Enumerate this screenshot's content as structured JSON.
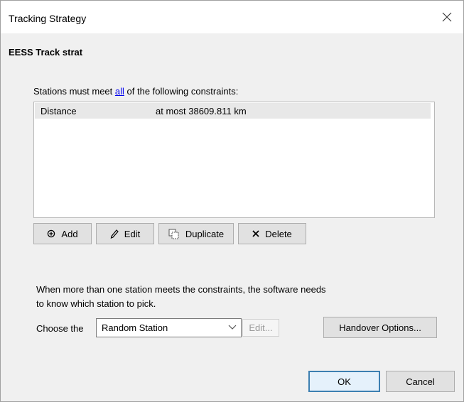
{
  "window": {
    "title": "Tracking Strategy",
    "close_icon": "close-icon"
  },
  "strategy_name": "EESS Track strat",
  "constraints": {
    "label_before": "Stations must meet ",
    "label_link": "all",
    "label_after": " of the following constraints:",
    "rows": [
      {
        "name": "Distance",
        "condition": "at most 38609.811 km"
      }
    ]
  },
  "list_actions": {
    "add": {
      "label": "Add",
      "icon": "plus-icon"
    },
    "edit": {
      "label": "Edit",
      "icon": "pencil-icon"
    },
    "duplicate": {
      "label": "Duplicate",
      "icon": "duplicate-icon"
    },
    "delete": {
      "label": "Delete",
      "icon": "x-icon"
    }
  },
  "selection": {
    "line1": "When more than one station meets the constraints, the software needs",
    "line2": "to know which station to pick.",
    "choose_label": "Choose the",
    "selected": "Random Station",
    "edit_label": "Edit...",
    "handover_label": "Handover Options..."
  },
  "footer": {
    "ok_label": "OK",
    "cancel_label": "Cancel"
  },
  "colors": {
    "link": "#0000ee",
    "default_border": "#3c7fb1",
    "row_highlight": "#e8e8e8"
  }
}
